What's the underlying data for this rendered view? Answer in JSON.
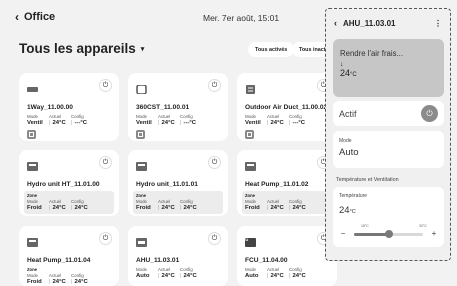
{
  "header": {
    "back_label": "Office",
    "datetime": "Mer. 7er août, 15:01"
  },
  "page_title": "Tous les appareils",
  "filters": [
    "Tous activés",
    "Tous inactifs"
  ],
  "devices": [
    {
      "name": "1Way_11.00.00",
      "mode_label": "Mode",
      "actual_label": "Actuel",
      "config_label": "Config",
      "mode": "Ventil",
      "actual": "24°C",
      "config": "---°C"
    },
    {
      "name": "360CST_11.00.01",
      "mode_label": "Mode",
      "actual_label": "Actuel",
      "config_label": "Config",
      "mode": "Ventil",
      "actual": "24°C",
      "config": "---°C"
    },
    {
      "name": "Outdoor Air Duct_11.00.02",
      "mode_label": "Mode",
      "actual_label": "Actuel",
      "config_label": "Config",
      "mode": "Ventil",
      "actual": "24°C",
      "config": "---°C"
    },
    {
      "name": "Hydro unit HT_11.01.00",
      "zone": "Zone",
      "mode_label": "Mode",
      "actual_label": "Actuel",
      "config_label": "Config",
      "mode": "Froid",
      "actual": "24°C",
      "config": "24°C"
    },
    {
      "name": "Hydro unit_11.01.01",
      "zone": "Zone",
      "mode_label": "Mode",
      "actual_label": "Actuel",
      "config_label": "Config",
      "mode": "Froid",
      "actual": "24°C",
      "config": "24°C"
    },
    {
      "name": "Heat Pump_11.01.02",
      "zone": "Zone",
      "mode_label": "Mode",
      "actual_label": "Actuel",
      "config_label": "Config",
      "mode": "Froid",
      "actual": "24°C",
      "config": "24°C"
    },
    {
      "name": "Heat Pump_11.01.04",
      "zone": "Zone",
      "mode_label": "Mode",
      "actual_label": "Actuel",
      "config_label": "Config",
      "mode": "Froid",
      "actual": "24°C",
      "config": "24°C"
    },
    {
      "name": "AHU_11.03.01",
      "mode_label": "Mode",
      "actual_label": "Actuel",
      "config_label": "Config",
      "mode": "Auto",
      "actual": "24°C",
      "config": "24°C"
    },
    {
      "name": "FCU_11.04.00",
      "badge": "FCU",
      "mode_label": "Mode",
      "actual_label": "Actuel",
      "config_label": "Config",
      "mode": "Auto",
      "actual": "24°C",
      "config": "24°C"
    }
  ],
  "panel": {
    "title": "AHU_11.03.01",
    "hero_text": "Rendre l'air frais...",
    "hero_temp": "24",
    "hero_unit": "°C",
    "actif_label": "Actif",
    "mode_label": "Mode",
    "mode_value": "Auto",
    "section_title": "Température et Ventilation",
    "temp_label": "Température",
    "temp_value": "24",
    "temp_unit": "°C",
    "range_min": "18°C",
    "range_max": "30°C",
    "slider_fraction": 0.5
  }
}
